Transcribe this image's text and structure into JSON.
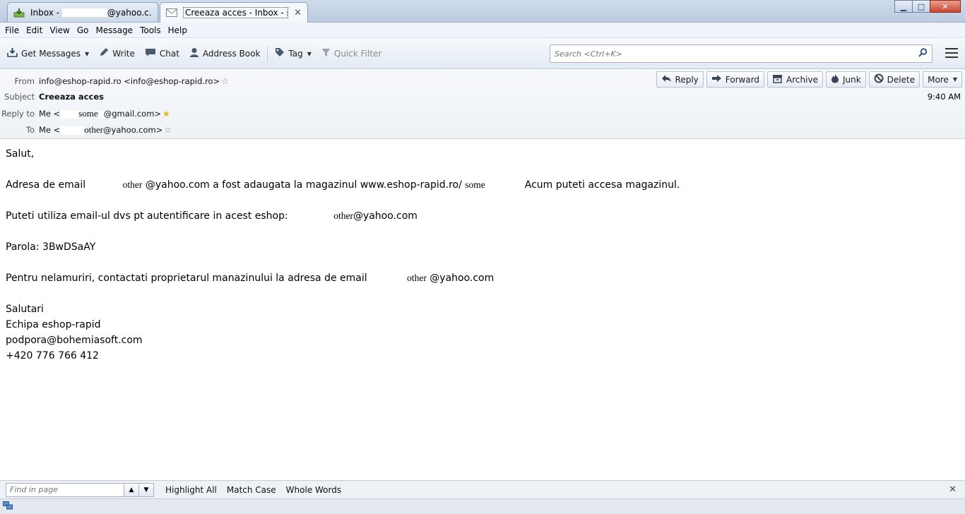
{
  "tabs": [
    {
      "title_prefix": "Inbox - ",
      "title_suffix": "@yahoo.c...",
      "icon": "inbox-download-icon",
      "active": false
    },
    {
      "title": "Creeaza acces - Inbox - sor...",
      "icon": "envelope-icon",
      "active": true
    }
  ],
  "window": {
    "minimize": "▁",
    "maximize": "□",
    "close": "✕"
  },
  "menu": [
    "File",
    "Edit",
    "View",
    "Go",
    "Message",
    "Tools",
    "Help"
  ],
  "toolbar": {
    "get_messages": "Get Messages",
    "write": "Write",
    "chat": "Chat",
    "address_book": "Address Book",
    "tag": "Tag",
    "quick_filter": "Quick Filter",
    "search_placeholder": "Search <Ctrl+K>"
  },
  "header": {
    "from_label": "From",
    "from_value": "info@eshop-rapid.ro <info@eshop-rapid.ro>",
    "subject_label": "Subject",
    "subject_value": "Creeaza acces",
    "replyto_label": "Reply to",
    "replyto_prefix": "Me <",
    "replyto_name": "some",
    "replyto_suffix": "@gmail.com>",
    "to_label": "To",
    "to_prefix": "Me <",
    "to_name": "other",
    "to_suffix": "@yahoo.com>",
    "time": "9:40 AM",
    "actions": {
      "reply": "Reply",
      "forward": "Forward",
      "archive": "Archive",
      "junk": "Junk",
      "delete": "Delete",
      "more": "More"
    }
  },
  "body": {
    "greeting": "Salut,",
    "line1_a": "Adresa de email ",
    "line1_name": "other",
    "line1_b": " @yahoo.com a fost adaugata la magazinul www.eshop-rapid.ro/",
    "line1_shop": "some",
    "line1_c": "Acum puteti accesa magazinul.",
    "line2_a": "Puteti utiliza email-ul dvs pt autentificare in acest eshop: ",
    "line2_name": "other",
    "line2_b": "@yahoo.com",
    "line3": "Parola: 3BwDSaAY",
    "line4_a": "Pentru nelamuriri, contactati proprietarul manazinului la adresa de email ",
    "line4_name": "other",
    "line4_b": " @yahoo.com",
    "sig1": "Salutari",
    "sig2": "Echipa eshop-rapid",
    "sig3": "podpora@bohemiasoft.com",
    "sig4": "+420 776 766 412"
  },
  "findbar": {
    "placeholder": "Find in page",
    "highlight_all": "Highlight All",
    "match_case": "Match Case",
    "whole_words": "Whole Words"
  }
}
